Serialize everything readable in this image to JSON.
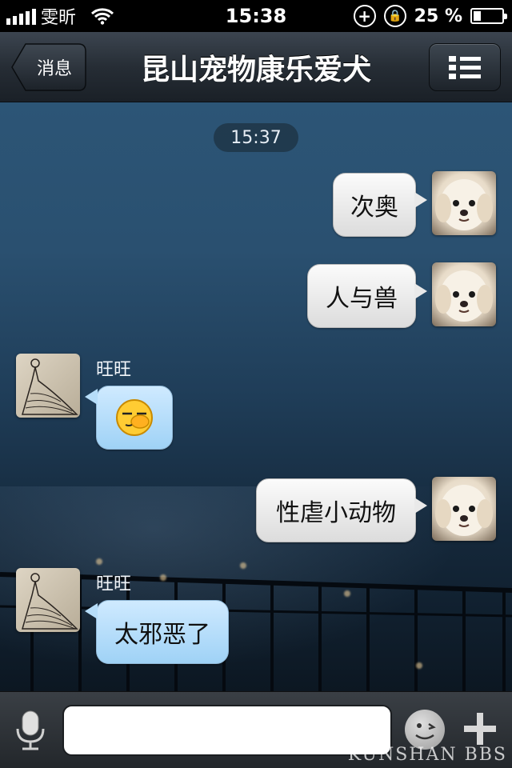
{
  "status_bar": {
    "carrier": "雯昕",
    "time": "15:38",
    "battery_percent": "25 %",
    "battery_level": 0.25
  },
  "nav": {
    "back_label": "消息",
    "title": "昆山宠物康乐爱犬",
    "menu_icon": "list-icon"
  },
  "chat": {
    "timestamp": "15:37",
    "messages": [
      {
        "direction": "out",
        "text": "次奥",
        "avatar": "dog-avatar"
      },
      {
        "direction": "out",
        "text": "人与兽",
        "avatar": "dog-avatar"
      },
      {
        "direction": "in",
        "sender": "旺旺",
        "emoji": "face-palm-emoji",
        "avatar": "dress-avatar"
      },
      {
        "direction": "out",
        "text": "性虐小动物",
        "avatar": "dog-avatar"
      },
      {
        "direction": "in",
        "sender": "旺旺",
        "text": "太邪恶了",
        "avatar": "dress-avatar"
      }
    ]
  },
  "input_bar": {
    "value": "",
    "mic_icon": "microphone-icon",
    "emoji_icon": "emoji-icon",
    "plus_icon": "plus-icon"
  },
  "watermark": "KUNSHAN BBS"
}
